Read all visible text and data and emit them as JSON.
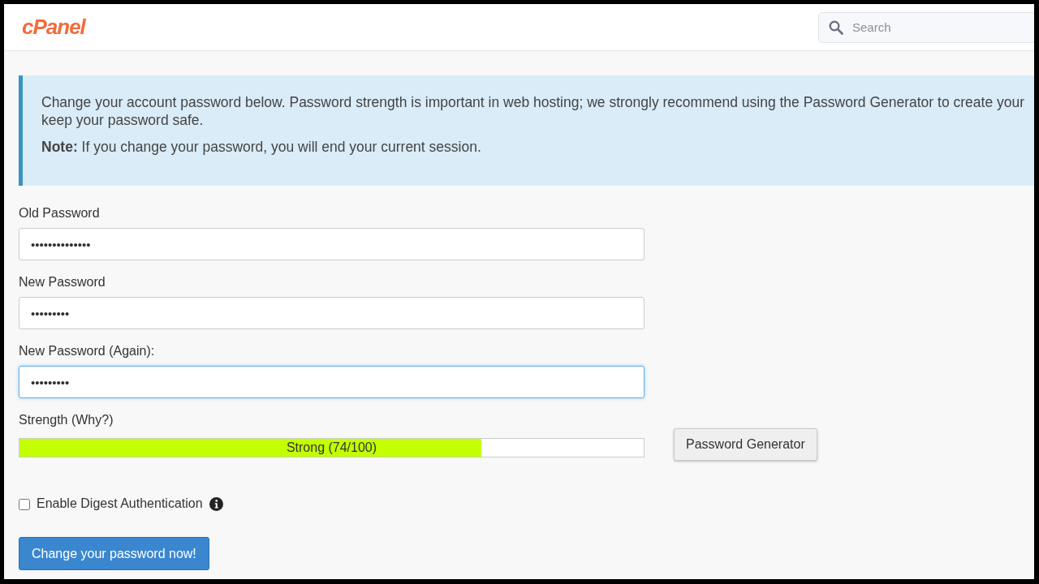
{
  "header": {
    "logo": "cPanel",
    "search": {
      "placeholder": "Search"
    }
  },
  "notice": {
    "lines": [
      "Change your account password below. Password strength is important in web hosting; we strongly recommend using the Password Generator to create your",
      "keep your password safe."
    ],
    "note": "**Note:** If you change your password, you will end your current session."
  },
  "fields": [
    {
      "label": "Old Password",
      "value": "••••••••••••••",
      "focused": false
    },
    {
      "label": "New Password",
      "value": "•••••••••",
      "focused": false
    },
    {
      "label": "New Password (Again):",
      "value": "•••••••••",
      "focused": true
    }
  ],
  "strength": {
    "label": "Strength (Why?)",
    "level": 0.74,
    "reading": "Strong (74/100)",
    "generator_button": "Password Generator"
  },
  "digest": {
    "label": "Enable Digest Authentication",
    "checked": false
  },
  "submit_button": "Change your password now!"
}
